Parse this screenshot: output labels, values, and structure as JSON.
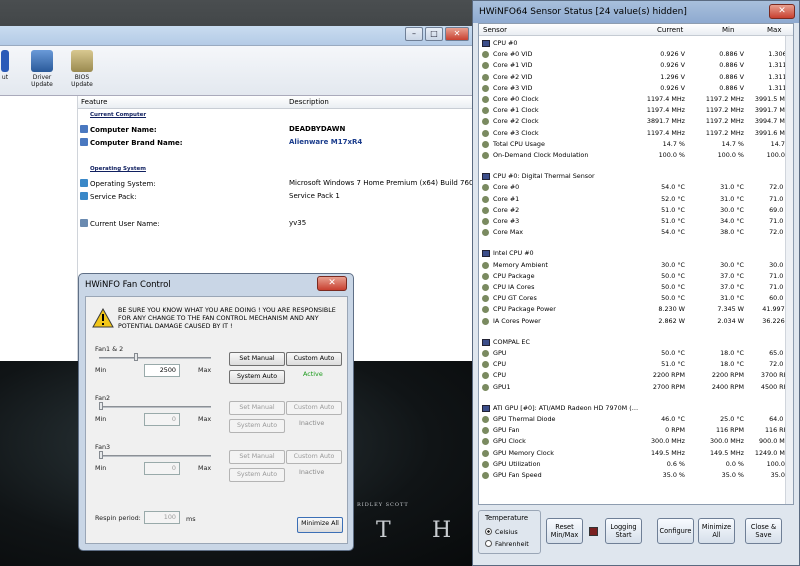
{
  "main_window": {
    "toolbar": [
      {
        "label": "ut"
      },
      {
        "label": "Driver Update"
      },
      {
        "label": "BIOS Update"
      }
    ],
    "columns": [
      "Feature",
      "Description"
    ],
    "sections": [
      {
        "title": "Current Computer",
        "rows": [
          {
            "feature": "Computer Name:",
            "value": "DEADBYDAWN"
          },
          {
            "feature": "Computer Brand Name:",
            "value": "Alienware M17xR4"
          }
        ]
      },
      {
        "title": "Operating System",
        "rows": [
          {
            "feature": "Operating System:",
            "value": "Microsoft Windows 7 Home Premium (x64) Build 7601"
          },
          {
            "feature": "Service Pack:",
            "value": "Service Pack 1"
          },
          {
            "feature": "Current User Name:",
            "value": "yv35"
          }
        ]
      }
    ]
  },
  "sensor_window": {
    "title": "HWiNFO64 Sensor Status [24 value(s) hidden]",
    "columns": [
      "Sensor",
      "Current",
      "Min",
      "Max"
    ],
    "groups": [
      {
        "name": "CPU #0",
        "rows": [
          [
            "Core #0 VID",
            "0.926 V",
            "0.886 V",
            "1.306 V"
          ],
          [
            "Core #1 VID",
            "0.926 V",
            "0.886 V",
            "1.311 V"
          ],
          [
            "Core #2 VID",
            "1.296 V",
            "0.886 V",
            "1.311 V"
          ],
          [
            "Core #3 VID",
            "0.926 V",
            "0.886 V",
            "1.311 V"
          ],
          [
            "Core #0 Clock",
            "1197.4 MHz",
            "1197.2 MHz",
            "3991.5 MHz"
          ],
          [
            "Core #1 Clock",
            "1197.4 MHz",
            "1197.2 MHz",
            "3991.7 MHz"
          ],
          [
            "Core #2 Clock",
            "3891.7 MHz",
            "1197.2 MHz",
            "3994.7 MHz"
          ],
          [
            "Core #3 Clock",
            "1197.4 MHz",
            "1197.2 MHz",
            "3991.6 MHz"
          ],
          [
            "Total CPU Usage",
            "14.7 %",
            "14.7 %",
            "14.7 %"
          ],
          [
            "On-Demand Clock Modulation",
            "100.0 %",
            "100.0 %",
            "100.0 %"
          ]
        ]
      },
      {
        "name": "CPU #0: Digital Thermal Sensor",
        "rows": [
          [
            "Core #0",
            "54.0 °C",
            "31.0 °C",
            "72.0 °C"
          ],
          [
            "Core #1",
            "52.0 °C",
            "31.0 °C",
            "71.0 °C"
          ],
          [
            "Core #2",
            "51.0 °C",
            "30.0 °C",
            "69.0 °C"
          ],
          [
            "Core #3",
            "51.0 °C",
            "34.0 °C",
            "71.0 °C"
          ],
          [
            "Core Max",
            "54.0 °C",
            "38.0 °C",
            "72.0 °C"
          ]
        ]
      },
      {
        "name": "Intel CPU #0",
        "rows": [
          [
            "Memory Ambient",
            "30.0 °C",
            "30.0 °C",
            "30.0 °C"
          ],
          [
            "CPU Package",
            "50.0 °C",
            "37.0 °C",
            "71.0 °C"
          ],
          [
            "CPU IA Cores",
            "50.0 °C",
            "37.0 °C",
            "71.0 °C"
          ],
          [
            "CPU GT Cores",
            "50.0 °C",
            "31.0 °C",
            "60.0 °C"
          ],
          [
            "CPU Package Power",
            "8.230 W",
            "7.345 W",
            "41.997 W"
          ],
          [
            "IA Cores Power",
            "2.862 W",
            "2.034 W",
            "36.226 W"
          ]
        ]
      },
      {
        "name": "COMPAL EC",
        "rows": [
          [
            "GPU",
            "50.0 °C",
            "18.0 °C",
            "65.0 °C"
          ],
          [
            "CPU",
            "51.0 °C",
            "18.0 °C",
            "72.0 °C"
          ],
          [
            "CPU",
            "2200 RPM",
            "2200 RPM",
            "3700 RPM"
          ],
          [
            "GPU1",
            "2700 RPM",
            "2400 RPM",
            "4500 RPM"
          ]
        ]
      },
      {
        "name": "ATI GPU [#0]: ATI/AMD Radeon HD 7970M (…",
        "rows": [
          [
            "GPU Thermal Diode",
            "46.0 °C",
            "25.0 °C",
            "64.0 °C"
          ],
          [
            "GPU Fan",
            "0 RPM",
            "116 RPM",
            "116 RPM"
          ],
          [
            "GPU Clock",
            "300.0 MHz",
            "300.0 MHz",
            "900.0 MHz"
          ],
          [
            "GPU Memory Clock",
            "149.5 MHz",
            "149.5 MHz",
            "1249.0 MHz"
          ],
          [
            "GPU Utilization",
            "0.6 %",
            "0.0 %",
            "100.0 %"
          ],
          [
            "GPU Fan Speed",
            "35.0 %",
            "35.0 %",
            "35.0 %"
          ]
        ]
      }
    ],
    "temperature_label": "Temperature",
    "celsius": "Celsius",
    "fahrenheit": "Fahrenheit",
    "buttons": {
      "reset": "Reset Min/Max",
      "logging": "Logging Start",
      "configure": "Configure",
      "minimize": "Minimize All",
      "close": "Close & Save"
    }
  },
  "fan_control": {
    "title": "HWiNFO Fan Control",
    "warning": "BE SURE YOU KNOW WHAT YOU ARE DOING ! YOU ARE RESPONSIBLE FOR ANY CHANGE TO THE FAN CONTROL MECHANISM AND ANY POTENTIAL DAMAGE CAUSED BY IT !",
    "min_label": "Min",
    "max_label": "Max",
    "fans": [
      {
        "name": "Fan1 & 2",
        "value": "2500",
        "level": 0.34,
        "status": "Active",
        "enabled": true
      },
      {
        "name": "Fan2",
        "value": "0",
        "level": 0.0,
        "status": "Inactive",
        "enabled": false
      },
      {
        "name": "Fan3",
        "value": "0",
        "level": 0.0,
        "status": "Inactive",
        "enabled": false
      }
    ],
    "set_manual": "Set Manual",
    "custom_auto": "Custom Auto",
    "system_auto": "System Auto",
    "respin_label": "Respin period:",
    "respin_value": "100",
    "respin_unit": "ms",
    "minimize_all": "Minimize All"
  },
  "poster": {
    "credit": "RIDLEY SCOTT",
    "letters": [
      "T",
      "H"
    ]
  },
  "colors": {
    "active": "#1a9a1a",
    "link": "#1a3c8c",
    "inactive": "#8a8a8a"
  }
}
